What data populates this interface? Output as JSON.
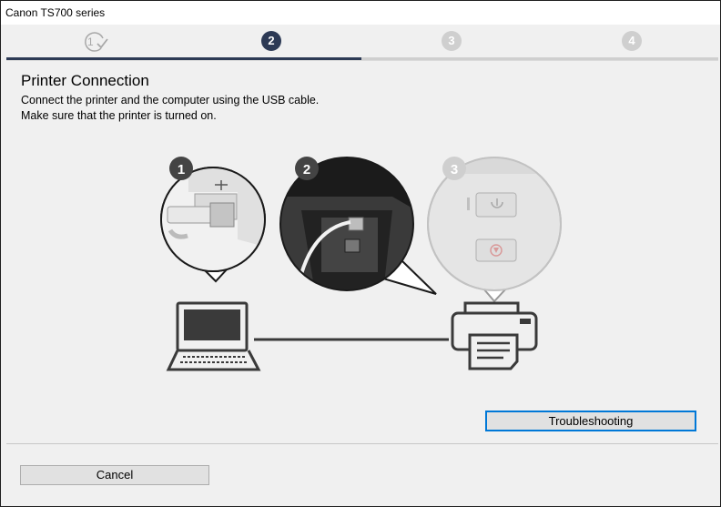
{
  "window": {
    "title": "Canon TS700 series"
  },
  "steps": [
    {
      "label": "1",
      "state": "done"
    },
    {
      "label": "2",
      "state": "active"
    },
    {
      "label": "3",
      "state": "upcoming"
    },
    {
      "label": "4",
      "state": "upcoming"
    }
  ],
  "page": {
    "heading": "Printer Connection",
    "instructions": [
      "Connect the printer and the computer using the USB cable.",
      "Make sure that the printer is turned on."
    ]
  },
  "illustration": {
    "callouts": [
      "1",
      "2",
      "3"
    ]
  },
  "buttons": {
    "troubleshooting": "Troubleshooting",
    "cancel": "Cancel"
  },
  "colors": {
    "active_step": "#2d3a55",
    "focus_border": "#0078d7"
  }
}
